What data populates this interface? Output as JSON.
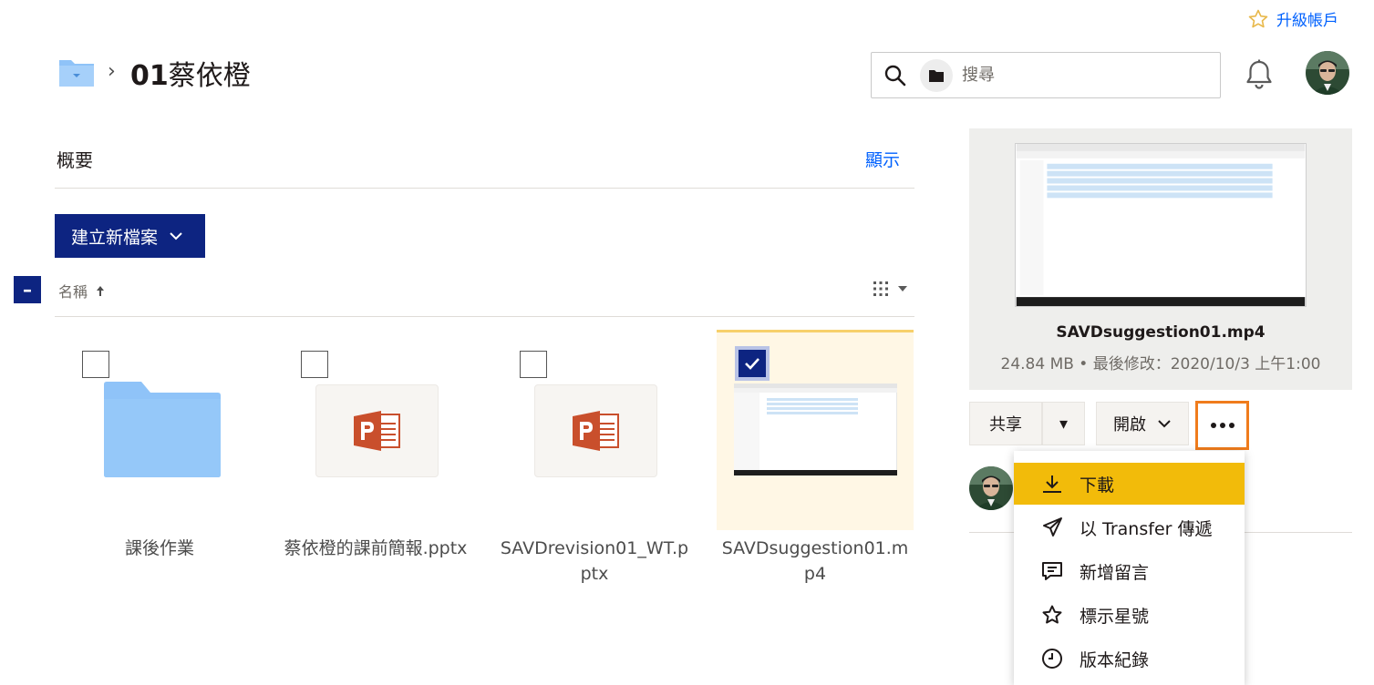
{
  "header": {
    "upgrade_label": "升級帳戶",
    "breadcrumb_sep": "›",
    "title_prefix": "01",
    "title_rest": "蔡依橙"
  },
  "search": {
    "placeholder": "搜尋"
  },
  "overview": {
    "title": "概要",
    "show_label": "顯示"
  },
  "toolbar": {
    "create_label": "建立新檔案",
    "select_all_glyph": "–",
    "column_name": "名稱"
  },
  "files": [
    {
      "name": "課後作業",
      "type": "folder",
      "selected": false
    },
    {
      "name": "蔡依橙的課前簡報.pptx",
      "type": "pptx",
      "selected": false
    },
    {
      "name": "SAVDrevision01_WT.pptx",
      "type": "pptx",
      "selected": false
    },
    {
      "name": "SAVDsuggestion01.mp4",
      "type": "video",
      "selected": true
    }
  ],
  "preview": {
    "file_name": "SAVDsuggestion01.mp4",
    "meta": "24.84 MB • 最後修改：2020/10/3 上午1:00"
  },
  "actions": {
    "share_label": "共享",
    "share_dropdown_glyph": "▾",
    "open_label": "開啟"
  },
  "menu": {
    "items": [
      {
        "label": "下載",
        "icon": "download-icon"
      },
      {
        "label": "以 Transfer 傳遞",
        "icon": "send-icon"
      },
      {
        "label": "新增留言",
        "icon": "comment-icon"
      },
      {
        "label": "標示星號",
        "icon": "star-icon"
      },
      {
        "label": "版本紀錄",
        "icon": "history-icon"
      }
    ],
    "active_index": 0
  },
  "colors": {
    "brand_navy": "#0d2481",
    "link_blue": "#0061fe",
    "menu_highlight": "#f2bb0a",
    "focus_orange": "#f07c1c",
    "selected_tile_bg": "#fff7e5"
  }
}
